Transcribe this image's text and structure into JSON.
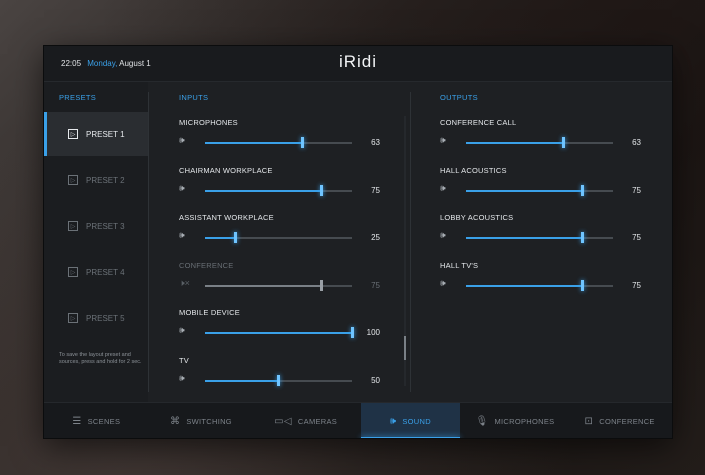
{
  "header": {
    "time": "22:05",
    "day": "Monday,",
    "date": "August 1",
    "logo": "iRidi"
  },
  "presets": {
    "title": "PRESETS",
    "items": [
      {
        "label": "PRESET 1",
        "active": true
      },
      {
        "label": "PRESET 2",
        "active": false
      },
      {
        "label": "PRESET 3",
        "active": false
      },
      {
        "label": "PRESET 4",
        "active": false
      },
      {
        "label": "PRESET 5",
        "active": false
      }
    ],
    "hint": "To save the layout preset and sources, press and hold for 2 sec."
  },
  "inputs": {
    "title": "INPUTS",
    "channels": [
      {
        "label": "MICROPHONES",
        "value": 63,
        "level": 0.66,
        "muted": false
      },
      {
        "label": "CHAIRMAN WORKPLACE",
        "value": 75,
        "level": 0.79,
        "muted": false
      },
      {
        "label": "ASSISTANT WORKPLACE",
        "value": 25,
        "level": 0.21,
        "muted": false
      },
      {
        "label": "CONFERENCE",
        "value": 75,
        "level": 0.79,
        "muted": true
      },
      {
        "label": "MOBILE DEVICE",
        "value": 100,
        "level": 1.0,
        "muted": false
      },
      {
        "label": "TV",
        "value": 50,
        "level": 0.5,
        "muted": false
      }
    ]
  },
  "outputs": {
    "title": "OUTPUTS",
    "channels": [
      {
        "label": "CONFERENCE CALL",
        "value": 63,
        "level": 0.66,
        "muted": false
      },
      {
        "label": "HALL ACOUSTICS",
        "value": 75,
        "level": 0.79,
        "muted": false
      },
      {
        "label": "LOBBY ACOUSTICS",
        "value": 75,
        "level": 0.79,
        "muted": false
      },
      {
        "label": "HALL TV'S",
        "value": 75,
        "level": 0.79,
        "muted": false
      }
    ]
  },
  "icons": {
    "speaker": "speaker-icon",
    "speaker_muted": "speaker-muted-icon",
    "preset": "play-icon"
  },
  "tabs": [
    {
      "label": "SCENES",
      "icon": "sliders-icon",
      "active": false
    },
    {
      "label": "SWITCHING",
      "icon": "switching-icon",
      "active": false
    },
    {
      "label": "CAMERAS",
      "icon": "camera-icon",
      "active": false
    },
    {
      "label": "SOUND",
      "icon": "speaker-icon",
      "active": true
    },
    {
      "label": "MICROPHONES",
      "icon": "microphone-icon",
      "active": false
    },
    {
      "label": "CONFERENCE",
      "icon": "conference-icon",
      "active": false
    }
  ],
  "colors": {
    "accent": "#3aa0e8",
    "background": "#1e2023"
  }
}
